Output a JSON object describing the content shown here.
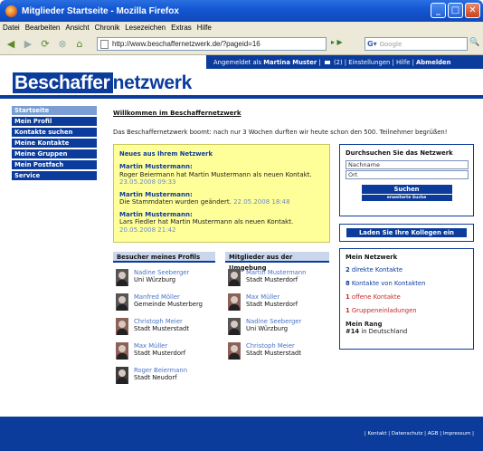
{
  "window": {
    "title": "Mitglieder Startseite - Mozilla Firefox",
    "min": "_",
    "max": "□",
    "close": "✕"
  },
  "menu": [
    "Datei",
    "Bearbeiten",
    "Ansicht",
    "Chronik",
    "Lesezeichen",
    "Extras",
    "Hilfe"
  ],
  "nav": {
    "url": "http://www.beschaffernetzwerk.de/?pageid=16",
    "search_placeholder": "Google",
    "back_icon": "back-arrow-icon",
    "forward_icon": "forward-arrow-icon",
    "reload_icon": "reload-icon",
    "stop_icon": "stop-icon",
    "home_icon": "home-icon"
  },
  "userbar": {
    "prefix": "Angemeldet als",
    "user": "Martina Muster",
    "messages": "(2)",
    "settings": "Einstellungen",
    "help": "Hilfe",
    "logout": "Abmelden"
  },
  "logo": {
    "part1": "Beschaffer",
    "part2": "netzwerk"
  },
  "sidenav": [
    "Startseite",
    "Mein Profil",
    "Kontakte suchen",
    "Meine Kontakte",
    "Meine Gruppen",
    "Mein Postfach",
    "Service"
  ],
  "welcome": "Willkommen im Beschaffernetzwerk",
  "intro": "Das Beschaffernetzwerk boomt: nach nur 3 Wochen durften wir heute schon den 500. Teilnehmer begrüßen!",
  "news": {
    "title": "Neues aus Ihrem Netzwerk",
    "items": [
      {
        "who": "Martin Mustermann:",
        "text": "Roger Beiermann hat Martin Mustermann als neuen Kontakt.",
        "when": "23.05.2008 09:33"
      },
      {
        "who": "Martin Mustermann:",
        "text": "Die Stammdaten wurden geändert.",
        "when": "22.05.2008 18:48"
      },
      {
        "who": "Martin Mustermann:",
        "text": "Lars Fiedler hat Martin Mustermann als neuen Kontakt.",
        "when": "20.05.2008 21:42"
      }
    ]
  },
  "search": {
    "title": "Durchsuchen Sie das Netzwerk",
    "field1": "Nachname",
    "field2": "Ort",
    "button": "Suchen",
    "advanced": "erweiterte Suche"
  },
  "invite": {
    "button": "Laden Sie Ihre Kollegen ein"
  },
  "network": {
    "title": "Mein Netzwerk",
    "rows": [
      {
        "num": "2",
        "label": "direkte Kontakte"
      },
      {
        "num": "8",
        "label": "Kontakte von Kontakten"
      },
      {
        "num": "1",
        "label": "offene Kontakte"
      },
      {
        "num": "1",
        "label": "Gruppeneinladungen"
      }
    ],
    "rank_label": "Mein Rang",
    "rank_value": "#14",
    "rank_suffix": "in Deutschland"
  },
  "visitors": {
    "title": "Besucher meines Profils",
    "people": [
      {
        "name": "Nadine Seeberger",
        "loc": "Uni Würzburg"
      },
      {
        "name": "Manfred Möller",
        "loc": "Gemeinde Musterberg"
      },
      {
        "name": "Christoph Meier",
        "loc": "Stadt Musterstadt"
      },
      {
        "name": "Max Müller",
        "loc": "Stadt Musterdorf"
      },
      {
        "name": "Roger Beiermann",
        "loc": "Stadt Neudorf"
      }
    ]
  },
  "nearby": {
    "title": "Mitglieder aus der Umgebung",
    "people": [
      {
        "name": "Martin Mustermann",
        "loc": "Stadt Musterdorf"
      },
      {
        "name": "Max Müller",
        "loc": "Stadt Musterdorf"
      },
      {
        "name": "Nadine Seeberger",
        "loc": "Uni Würzburg"
      },
      {
        "name": "Christoph Meier",
        "loc": "Stadt Musterstadt"
      }
    ]
  },
  "footer": {
    "links": "| Kontakt | Datenschutz | AGB | Impressum |"
  }
}
